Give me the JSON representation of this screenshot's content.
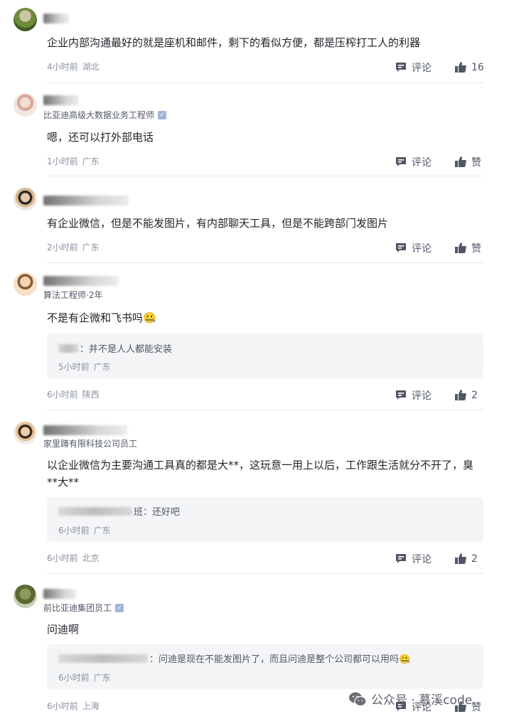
{
  "comments": [
    {
      "subtitle": "",
      "content": "企业内部沟通最好的就是座机和邮件，剩下的看似方便，都是压榨打工人的利器",
      "time": "4小时前",
      "location": "湖北",
      "comment_label": "评论",
      "like_label": "16"
    },
    {
      "subtitle": "比亚迪高级大数据业务工程师",
      "content": "嗯，还可以打外部电话",
      "time": "1小时前",
      "location": "广东",
      "comment_label": "评论",
      "like_label": "赞"
    },
    {
      "subtitle": "",
      "content": "有企业微信，但是不能发图片，有内部聊天工具，但是不能跨部门发图片",
      "time": "2小时前",
      "location": "广东",
      "comment_label": "评论",
      "like_label": "赞"
    },
    {
      "subtitle": "算法工程师·2年",
      "content": "不是有企微和飞书吗🤐",
      "reply": {
        "text": "：并不是人人都能安装",
        "time": "5小时前",
        "location": "广东"
      },
      "time": "6小时前",
      "location": "陕西",
      "comment_label": "评论",
      "like_label": "2"
    },
    {
      "subtitle": "家里蹲有限科技公司员工",
      "content": "以企业微信为主要沟通工具真的都是大**，这玩意一用上以后，工作跟生活就分不开了，臭**大**",
      "reply": {
        "text": "班：还好吧",
        "time": "6小时前",
        "location": "广东"
      },
      "time": "6小时前",
      "location": "北京",
      "comment_label": "评论",
      "like_label": "2"
    },
    {
      "subtitle": "前比亚迪集团员工",
      "content": "问迪啊",
      "reply": {
        "text": "：问迪是现在不能发图片了，而且问迪是整个公司都可以用吗🤐",
        "time": "6小时前",
        "location": "广东"
      },
      "time": "6小时前",
      "location": "上海",
      "comment_label": "评论",
      "like_label": "赞"
    }
  ],
  "watermark": {
    "text": "公众号 · 慕溪code"
  },
  "colors": {
    "text": "#1f2329",
    "meta": "#8a919f",
    "reply_bg": "#f4f5f7",
    "divider": "#e4e6eb"
  }
}
